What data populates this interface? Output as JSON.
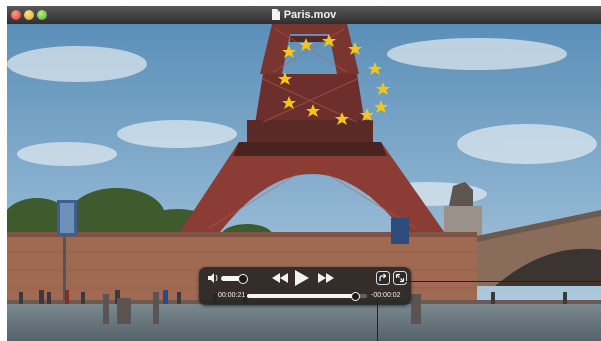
{
  "window": {
    "title": "Paris.mov"
  },
  "player": {
    "elapsed_time": "00:00:21",
    "remaining_time": "-00:00:02",
    "progress": 0.9,
    "volume": 0.75
  },
  "icons": {
    "close": "close-button",
    "minimize": "minimize-button",
    "zoom": "zoom-button",
    "document": "document-icon",
    "volume": "speaker-icon",
    "rewind": "rewind-icon",
    "play": "play-icon",
    "fast_forward": "fast-forward-icon",
    "share": "share-icon",
    "fullscreen": "fullscreen-icon"
  },
  "colors": {
    "titlebar": "#3a3a3a",
    "controls_hud": "#232323",
    "star": "#f5c518"
  }
}
